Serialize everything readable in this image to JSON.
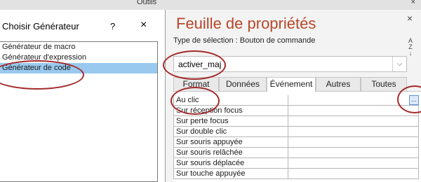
{
  "ribbon": {
    "tab_label": "Outils",
    "close_glyph": "×"
  },
  "dialog": {
    "title": "Choisir Générateur",
    "help_glyph": "?",
    "close_glyph": "×",
    "items": [
      {
        "label": "Générateur de macro",
        "selected": false
      },
      {
        "label": "Générateur d'expression",
        "selected": false
      },
      {
        "label": "Générateur de code",
        "selected": true
      }
    ]
  },
  "property_sheet": {
    "title": "Feuille de propriétés",
    "close_glyph": "×",
    "selection_type": "Type de sélection : Bouton de commande",
    "sort_icon": "sort-az-icon",
    "object_combo": {
      "value": "activer_maj",
      "arrow_glyph": "⌵"
    },
    "tabs": [
      "Format",
      "Données",
      "Événement",
      "Autres",
      "Toutes"
    ],
    "active_tab": "Événement",
    "builder_glyph": "...",
    "dropdown_glyph": "⌵",
    "rows": [
      "Au clic",
      "Sur réception focus",
      "Sur perte focus",
      "Sur double clic",
      "Sur souris appuyée",
      "Sur souris relâchée",
      "Sur souris déplacée",
      "Sur touche appuyée"
    ]
  },
  "colors": {
    "title_accent": "#b7472a",
    "selection_highlight": "#99c9ef",
    "annotation": "#a42a2a"
  }
}
